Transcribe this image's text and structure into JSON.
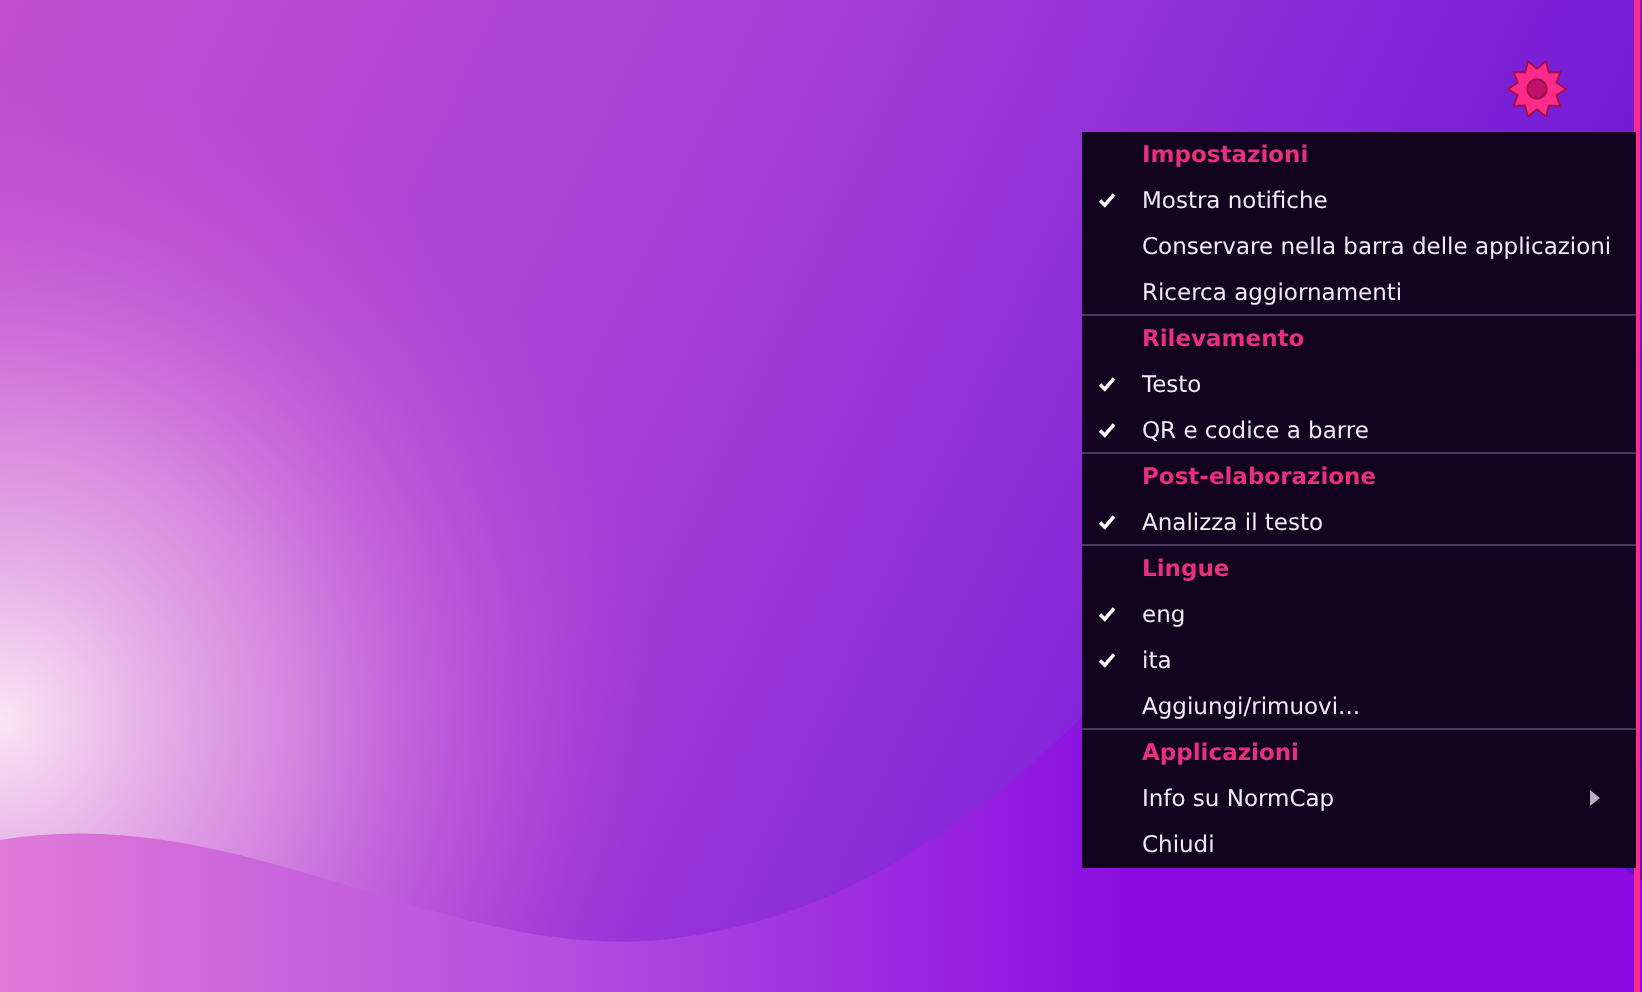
{
  "menu": {
    "sections": [
      {
        "title": "Impostazioni",
        "items": [
          {
            "label": "Mostra notifiche",
            "checked": true,
            "submenu": false
          },
          {
            "label": "Conservare nella barra delle applicazioni",
            "checked": false,
            "submenu": false
          },
          {
            "label": "Ricerca aggiornamenti",
            "checked": false,
            "submenu": false
          }
        ]
      },
      {
        "title": "Rilevamento",
        "items": [
          {
            "label": "Testo",
            "checked": true,
            "submenu": false
          },
          {
            "label": "QR e codice a barre",
            "checked": true,
            "submenu": false
          }
        ]
      },
      {
        "title": "Post-elaborazione",
        "items": [
          {
            "label": "Analizza il testo",
            "checked": true,
            "submenu": false
          }
        ]
      },
      {
        "title": "Lingue",
        "items": [
          {
            "label": "eng",
            "checked": true,
            "submenu": false
          },
          {
            "label": "ita",
            "checked": true,
            "submenu": false
          },
          {
            "label": "Aggiungi/rimuovi...",
            "checked": false,
            "submenu": false
          }
        ]
      },
      {
        "title": "Applicazioni",
        "items": [
          {
            "label": "Info su NormCap",
            "checked": false,
            "submenu": true
          },
          {
            "label": "Chiudi",
            "checked": false,
            "submenu": false
          }
        ]
      }
    ]
  }
}
